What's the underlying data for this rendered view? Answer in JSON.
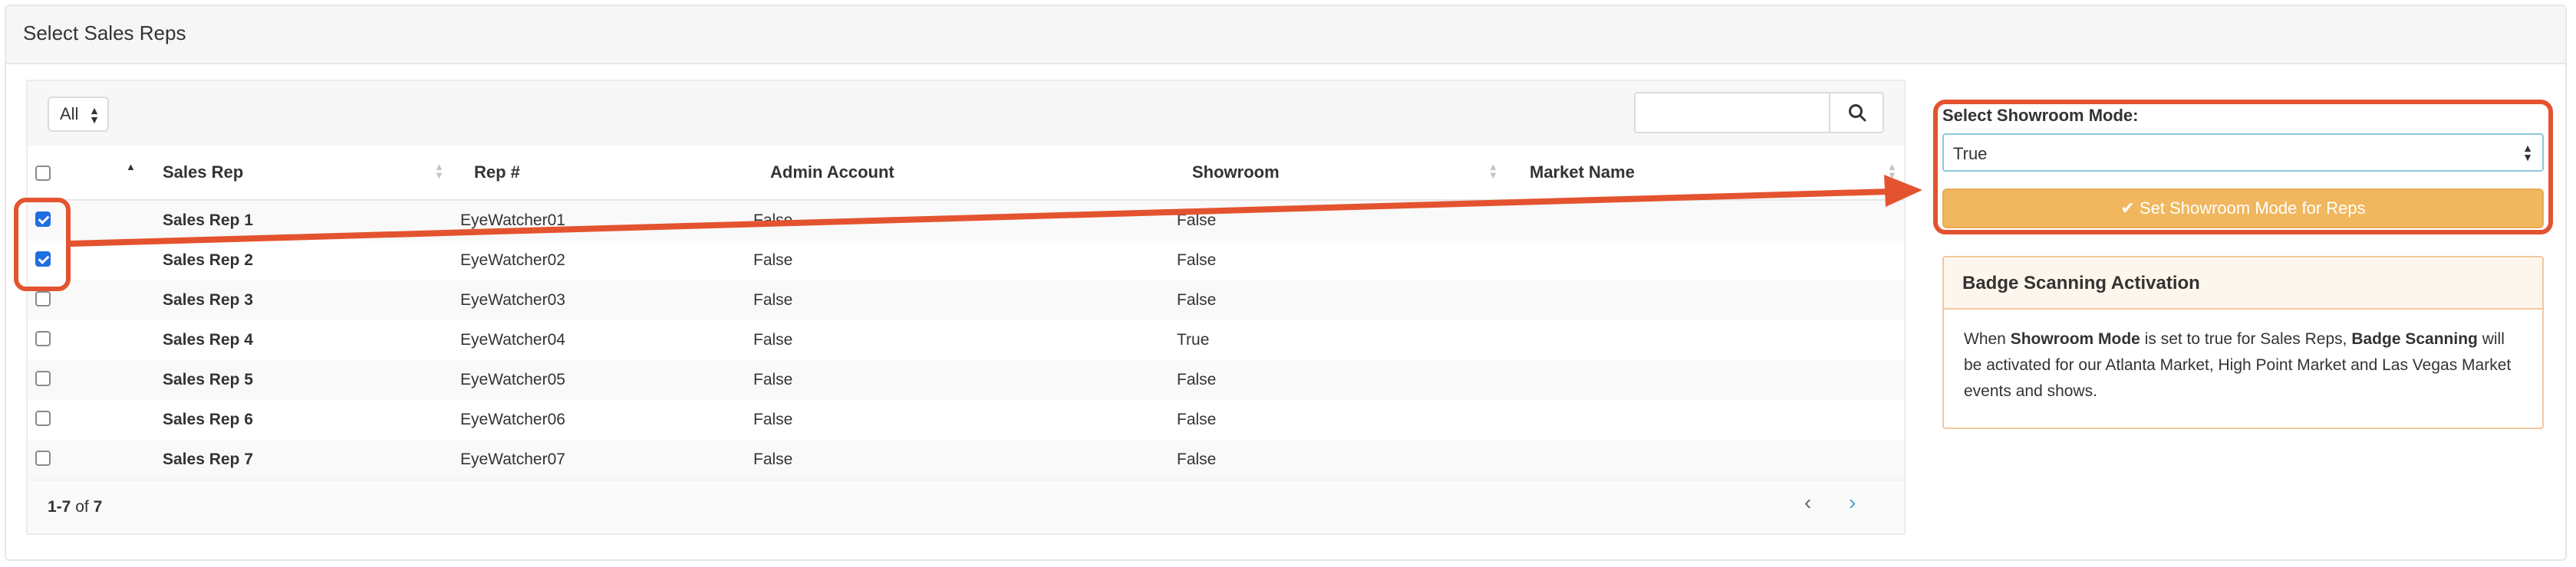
{
  "panel": {
    "title": "Select Sales Reps"
  },
  "table": {
    "filter_value": "All",
    "search": {
      "value": ""
    },
    "headers": [
      "Sales Rep",
      "Rep #",
      "Admin Account",
      "Showroom",
      "Market Name"
    ],
    "rows": [
      {
        "name": "Sales Rep 1",
        "rep": "EyeWatcher01",
        "admin": "False",
        "showroom": "False",
        "market": "",
        "checked": true
      },
      {
        "name": "Sales Rep 2",
        "rep": "EyeWatcher02",
        "admin": "False",
        "showroom": "False",
        "market": "",
        "checked": true
      },
      {
        "name": "Sales Rep 3",
        "rep": "EyeWatcher03",
        "admin": "False",
        "showroom": "False",
        "market": "",
        "checked": false
      },
      {
        "name": "Sales Rep 4",
        "rep": "EyeWatcher04",
        "admin": "False",
        "showroom": "True",
        "market": "",
        "checked": false
      },
      {
        "name": "Sales Rep 5",
        "rep": "EyeWatcher05",
        "admin": "False",
        "showroom": "False",
        "market": "",
        "checked": false
      },
      {
        "name": "Sales Rep 6",
        "rep": "EyeWatcher06",
        "admin": "False",
        "showroom": "False",
        "market": "",
        "checked": false
      },
      {
        "name": "Sales Rep 7",
        "rep": "EyeWatcher07",
        "admin": "False",
        "showroom": "False",
        "market": "",
        "checked": false
      }
    ],
    "pagination": {
      "range": "1-7",
      "of_label": "of",
      "total": "7"
    }
  },
  "showroom": {
    "label": "Select Showroom Mode:",
    "selected": "True",
    "button_label": "Set Showroom Mode for Reps"
  },
  "badge": {
    "title": "Badge Scanning Activation",
    "text_1": "When ",
    "bold_1": "Showroom Mode",
    "text_2": " is set to true for Sales Reps, ",
    "bold_2": "Badge Scanning",
    "text_3": " will be activated for our Atlanta Market, High Point Market and Las Vegas Market events and shows."
  },
  "colors": {
    "highlight": "#e4532f",
    "button": "#f0b75e",
    "checkbox": "#1f6fe0"
  },
  "icons": {
    "search": "search-icon",
    "check": "check-icon",
    "prev": "chevron-left-icon",
    "next": "chevron-right-icon"
  }
}
